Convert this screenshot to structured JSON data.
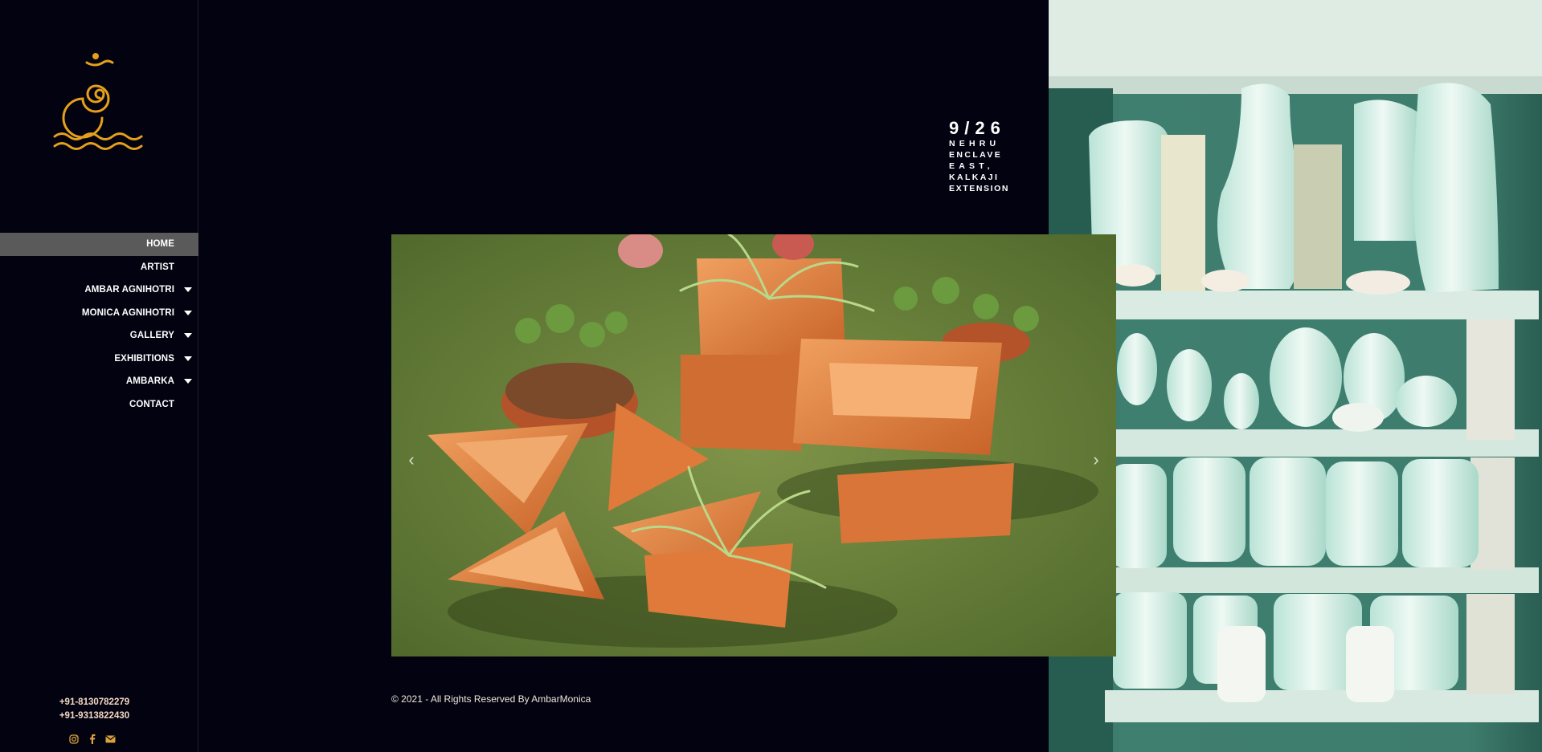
{
  "colors": {
    "background": "#030210",
    "accent": "#e5a01c",
    "nav_active": "#5a5a5a"
  },
  "logo": {
    "icon": "spiral-waves-logo"
  },
  "nav": {
    "items": [
      {
        "label": "HOME",
        "active": true,
        "has_submenu": false
      },
      {
        "label": "ARTIST",
        "active": false,
        "has_submenu": false
      },
      {
        "label": "AMBAR AGNIHOTRI",
        "active": false,
        "has_submenu": true
      },
      {
        "label": "MONICA AGNIHOTRI",
        "active": false,
        "has_submenu": true
      },
      {
        "label": "GALLERY",
        "active": false,
        "has_submenu": true
      },
      {
        "label": "EXHIBITIONS",
        "active": false,
        "has_submenu": true
      },
      {
        "label": "AMBARKA",
        "active": false,
        "has_submenu": true
      },
      {
        "label": "CONTACT",
        "active": false,
        "has_submenu": false
      }
    ]
  },
  "contact": {
    "phone1": "+91-8130782279",
    "phone2": "+91-9313822430",
    "socials": [
      "instagram-icon",
      "facebook-icon",
      "envelope-icon"
    ]
  },
  "address": {
    "number": "9/26",
    "lines": [
      "NEHRU",
      "ENCLAVE",
      "EAST,",
      "KALKAJI",
      "EXTENSION"
    ]
  },
  "slider": {
    "prev_icon": "chevron-left-icon",
    "next_icon": "chevron-right-icon",
    "image": "terracotta planters on grass"
  },
  "footer": {
    "copyright": "© 2021 - All Rights Reserved By AmbarMonica"
  }
}
